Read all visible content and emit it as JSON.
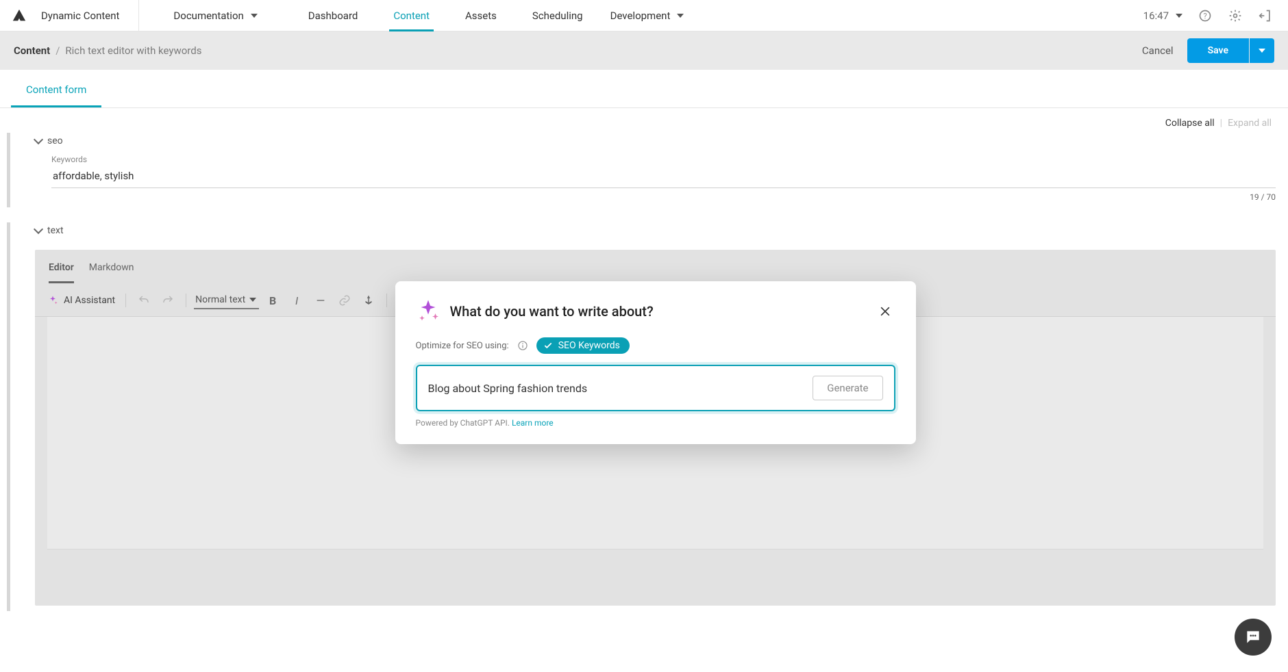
{
  "topnav": {
    "brand": "Dynamic Content",
    "documentation_label": "Documentation",
    "tabs": [
      "Dashboard",
      "Content",
      "Assets",
      "Scheduling"
    ],
    "active_tab_index": 1,
    "development_label": "Development",
    "time": "16:47"
  },
  "crumb": {
    "root": "Content",
    "current": "Rich text editor with keywords",
    "cancel": "Cancel",
    "save": "Save"
  },
  "content_form_tab": "Content form",
  "collapse_expand": {
    "collapse": "Collapse all",
    "expand": "Expand all"
  },
  "section_seo": {
    "title": "seo",
    "keywords_label": "Keywords",
    "keywords_value": "affordable, stylish",
    "char_count": "19 / 70"
  },
  "section_text": {
    "title": "text"
  },
  "editor": {
    "tabs": [
      "Editor",
      "Markdown"
    ],
    "active_tab_index": 0,
    "ai_assistant": "AI Assistant",
    "normal_text": "Normal text"
  },
  "dialog": {
    "title": "What do you want to write about?",
    "optimize_label": "Optimize for SEO using:",
    "seo_chip": "SEO Keywords",
    "prompt_value": "Blog about Spring fashion trends",
    "generate": "Generate",
    "powered": "Powered by ChatGPT API. ",
    "learn_more": "Learn more"
  }
}
